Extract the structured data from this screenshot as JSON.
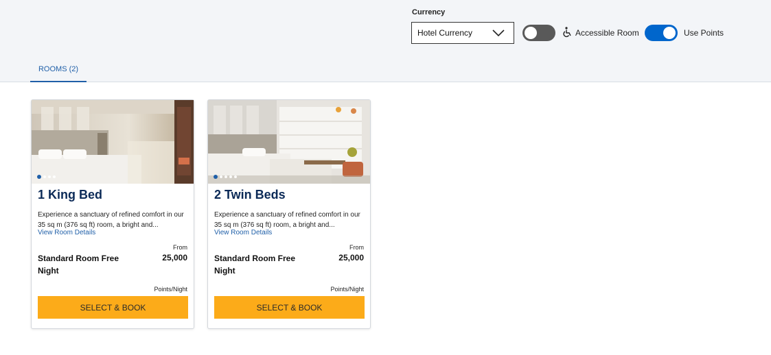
{
  "filters": {
    "currency_label": "Currency",
    "currency_value": "Hotel Currency",
    "accessible_label": "Accessible Room",
    "accessible_on": false,
    "points_label": "Use Points",
    "points_on": true
  },
  "tabs": {
    "rooms_label": "ROOMS (2)"
  },
  "colors": {
    "accent": "#fcab19",
    "link": "#1f5fa8",
    "title": "#0b2a57",
    "toggle_on": "#0066cc",
    "toggle_off": "#595959"
  },
  "rooms": [
    {
      "title": "1 King Bed",
      "description": "Experience a sanctuary of refined comfort in our 35 sq m (376 sq ft) room, a bright and...",
      "details_link": "View Room Details",
      "from_label": "From",
      "rate_name": "Standard Room Free Night",
      "points": "25,000",
      "points_unit": "Points/Night",
      "button_label": "SELECT & BOOK",
      "slide_count": 4,
      "active_slide": 1
    },
    {
      "title": "2 Twin Beds",
      "description": "Experience a sanctuary of refined comfort in our 35 sq m (376 sq ft) room, a bright and...",
      "details_link": "View Room Details",
      "from_label": "From",
      "rate_name": "Standard Room Free Night",
      "points": "25,000",
      "points_unit": "Points/Night",
      "button_label": "SELECT & BOOK",
      "slide_count": 5,
      "active_slide": 1
    }
  ]
}
